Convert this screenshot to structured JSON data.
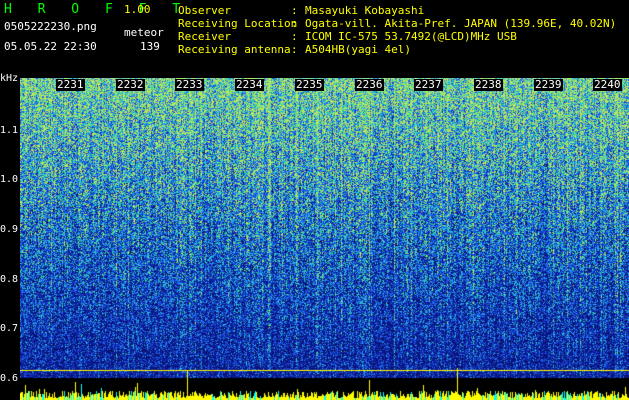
{
  "header": {
    "app_title": "H R O F F T",
    "version": "1.00",
    "filename": "0505222230.png",
    "mode": "meteor",
    "datetime": "05.05.22 22:30",
    "count": "139"
  },
  "info": [
    {
      "label": "Observer",
      "value": "Masayuki Kobayashi"
    },
    {
      "label": "Receiving Location",
      "value": "Ogata-vill. Akita-Pref. JAPAN (139.96E, 40.02N)"
    },
    {
      "label": "Receiver",
      "value": "ICOM IC-575 53.7492(@LCD)MHz USB"
    },
    {
      "label": "Receiving antenna",
      "value": "A504HB(yagi 4el)"
    }
  ],
  "axis": {
    "y_unit": "kHz",
    "y_ticks": [
      "1.1",
      "1.0",
      "0.9",
      "0.8",
      "0.7",
      "0.6"
    ],
    "x_ticks": [
      "2231",
      "2232",
      "2233",
      "2234",
      "2235",
      "2236",
      "2237",
      "2238",
      "2239",
      "2240"
    ]
  },
  "colors": {
    "title": "#00ff00",
    "info_text": "#ffff00",
    "axis_text": "#ffffff",
    "background": "#000000",
    "ref_line": "#ffff00"
  }
}
